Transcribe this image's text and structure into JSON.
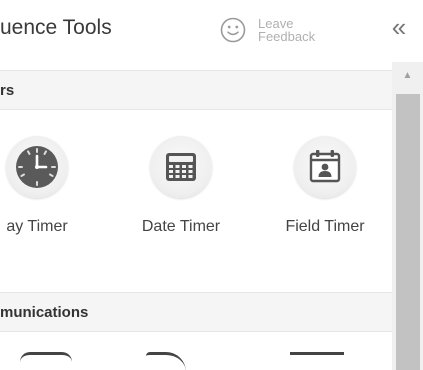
{
  "header": {
    "title": "uence Tools",
    "feedback_label": "Leave Feedback",
    "collapse_glyph": "«",
    "feedback_icon": "smiley-icon",
    "collapse_icon": "double-chevron-left-icon"
  },
  "sections": [
    {
      "title": "rs",
      "items": [
        {
          "label": "ay Timer",
          "icon": "clock-icon"
        },
        {
          "label": "Date Timer",
          "icon": "calculator-icon"
        },
        {
          "label": "Field Timer",
          "icon": "calendar-contact-icon"
        }
      ]
    },
    {
      "title": "munications"
    }
  ],
  "scrollbar": {
    "up_glyph": "▲"
  },
  "colors": {
    "accent_gray": "#555555",
    "section_bg": "#f5f5f5",
    "scroll_thumb": "#c2c2c2"
  }
}
